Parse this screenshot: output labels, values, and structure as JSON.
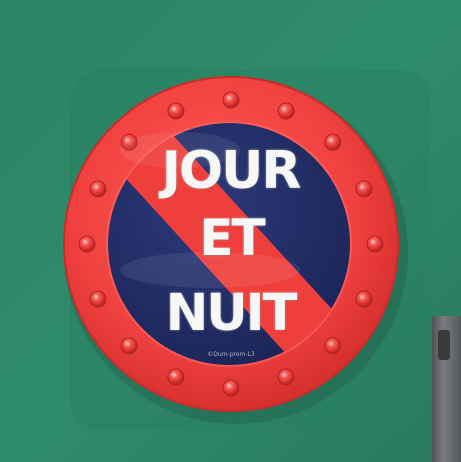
{
  "sign": {
    "line1": "JOUR",
    "line2": "ET",
    "line3": "NUIT",
    "maker_mark": "©Dum-prom-L3"
  },
  "colors": {
    "wall": "#2f8a6a",
    "ring_red": "#f0413f",
    "field_blue": "#23306a",
    "text": "#ffffff"
  },
  "scene": {
    "subject": "round French no-parking sign",
    "rivets_on_ring": 16,
    "mounting_bracket_visible": true
  }
}
